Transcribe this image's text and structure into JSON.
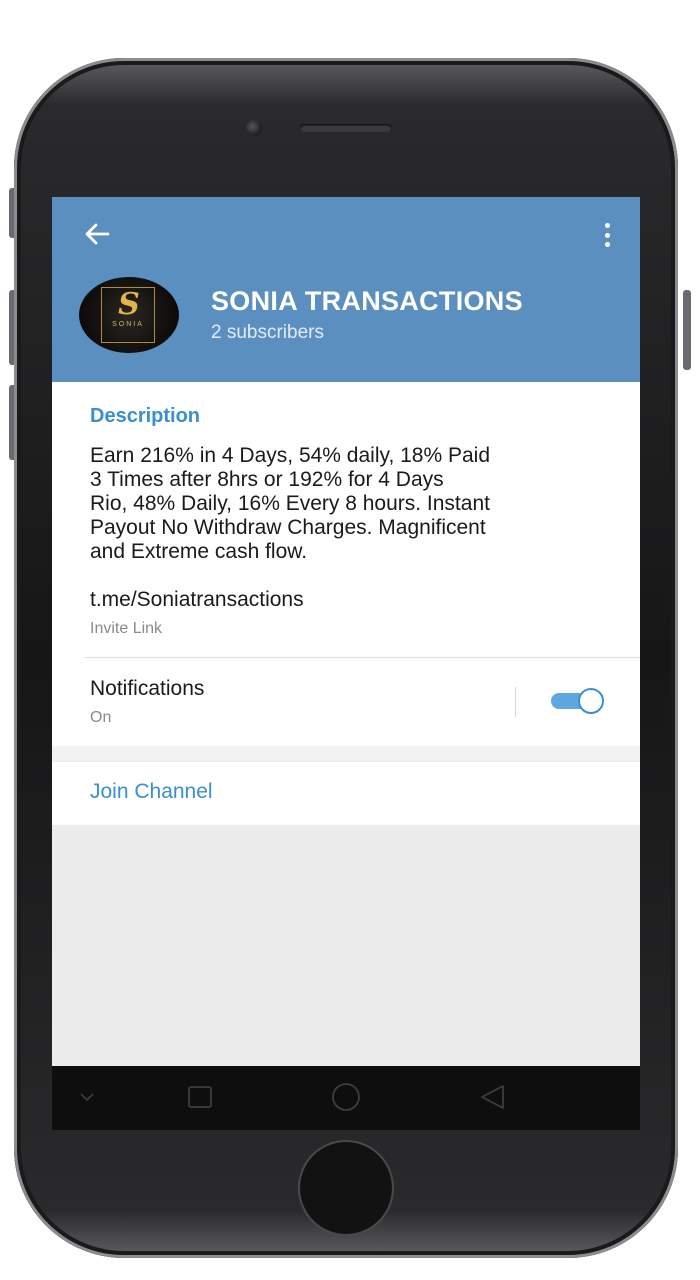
{
  "header": {
    "title": "SONIA TRANSACTIONS",
    "subscribers": "2 subscribers",
    "back_icon": "arrow-left-icon",
    "menu_icon": "more-vertical-icon",
    "background_color": "#5b8fc0"
  },
  "avatar": {
    "monogram": "S",
    "text": "SONIA"
  },
  "info": {
    "description_label": "Description",
    "description_lines": [
      "Earn 216% in 4 Days, 54% daily, 18% Paid",
      "3 Times after 8hrs or 192% for 4 Days",
      "Rio, 48% Daily, 16% Every 8 hours. Instant",
      "Payout No Withdraw Charges. Magnificent",
      "and Extreme cash flow."
    ],
    "link": "t.me/Soniatransactions",
    "link_caption": "Invite Link",
    "accent_color": "#3a8fd0"
  },
  "notifications": {
    "label": "Notifications",
    "state": "On",
    "toggle_on": true
  },
  "join": {
    "label": "Join Channel"
  },
  "navbar": {
    "icons": [
      "chevron-down-icon",
      "recent-apps-icon",
      "home-icon",
      "back-triangle-icon"
    ]
  }
}
